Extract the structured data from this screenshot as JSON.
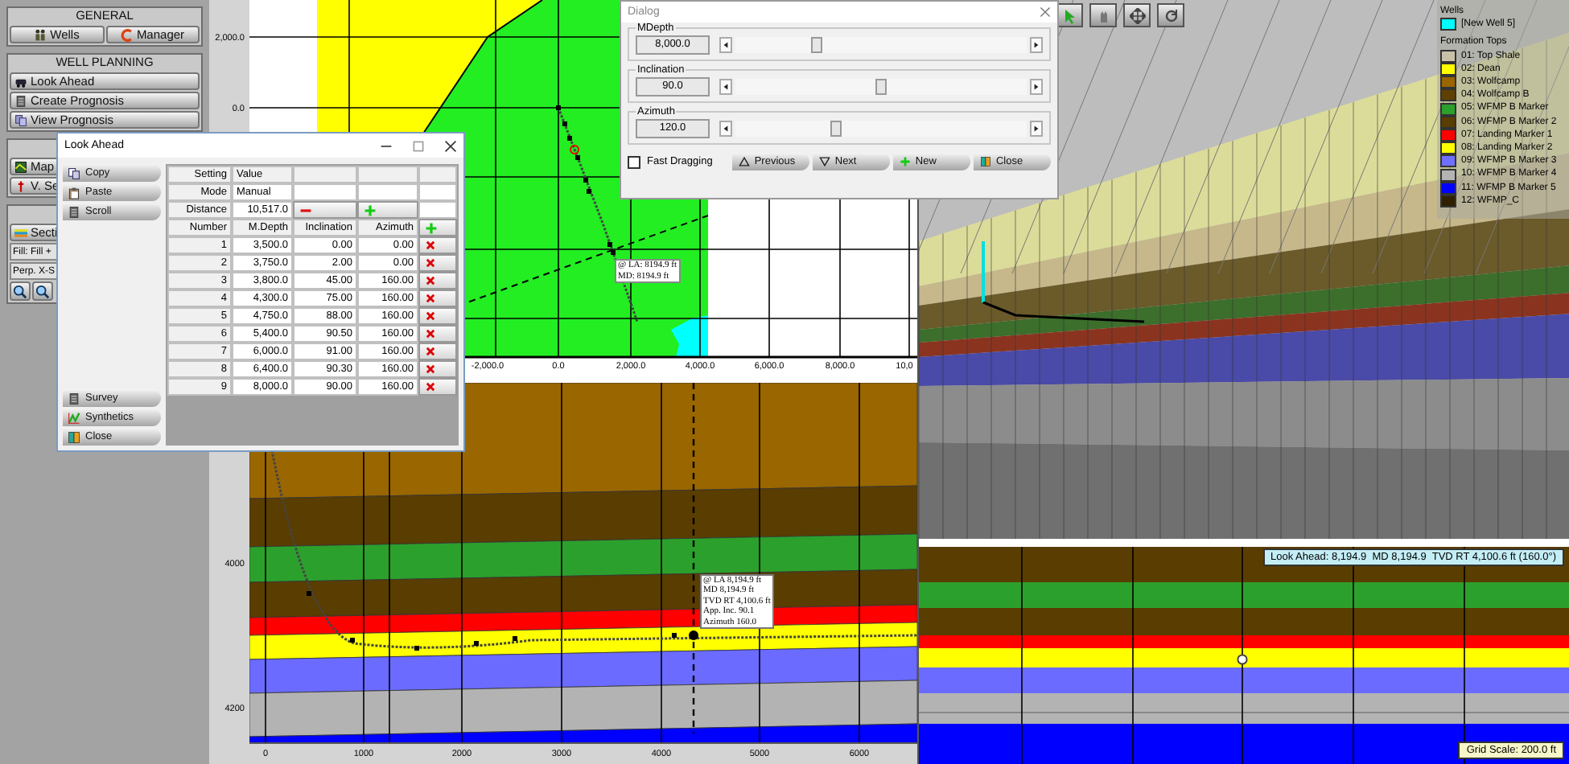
{
  "sidebar": {
    "sections": [
      {
        "title": "GENERAL",
        "buttons": [
          {
            "label": "Wells"
          },
          {
            "label": "Manager"
          }
        ]
      },
      {
        "title": "WELL PLANNING",
        "buttons": [
          {
            "label": "Look Ahead"
          },
          {
            "label": "Create Prognosis"
          },
          {
            "label": "View Prognosis"
          }
        ]
      },
      {
        "buttons": [
          {
            "label": "Map"
          },
          {
            "label": "V. Se"
          }
        ]
      },
      {
        "buttons": [
          {
            "label": "Secti"
          }
        ],
        "fields": [
          {
            "value": "Fill: Fill +"
          },
          {
            "value": "Perp. X-S"
          }
        ]
      }
    ]
  },
  "map_view": {
    "yticks": [
      "2,000.0",
      "0.0"
    ],
    "xticks": [
      "-2,000.0",
      "0.0",
      "2,000.0",
      "4,000.0",
      "6,000.0",
      "8,000.0",
      "10,0"
    ],
    "marker_label": [
      "@ LA: 8194.9 ft",
      "MD: 8194.9 ft"
    ]
  },
  "section_view": {
    "yticks": [
      "4000",
      "4200"
    ],
    "xticks": [
      "0",
      "1000",
      "2000",
      "3000",
      "4000",
      "5000",
      "6000"
    ],
    "tooltip": [
      "@ LA 8,194.9 ft",
      "MD 8,194.9 ft",
      "TVD RT 4,100.6 ft",
      "App. Inc. 90.1",
      "Azimuth 160.0"
    ]
  },
  "view_3d": {
    "legend": {
      "wells_title": "Wells",
      "wells": [
        {
          "name": "[New Well 5]",
          "color": "#00ffff"
        }
      ],
      "tops_title": "Formation Tops",
      "tops": [
        {
          "name": "01: Top Shale",
          "color": "#c8c0a8"
        },
        {
          "name": "02: Dean",
          "color": "#ffff00"
        },
        {
          "name": "03: Wolfcamp",
          "color": "#996600"
        },
        {
          "name": "04: Wolfcamp B",
          "color": "#604000"
        },
        {
          "name": "05: WFMP B Marker",
          "color": "#2ca02c"
        },
        {
          "name": "06: WFMP B Marker 2",
          "color": "#5a3d00"
        },
        {
          "name": "07: Landing Marker 1",
          "color": "#ff0000"
        },
        {
          "name": "08: Landing Marker 2",
          "color": "#ffff00"
        },
        {
          "name": "09: WFMP B Marker 3",
          "color": "#7070ff"
        },
        {
          "name": "10: WFMP B Marker 4",
          "color": "#b4b4b4"
        },
        {
          "name": "11: WFMP B Marker 5",
          "color": "#0000ff"
        },
        {
          "name": "12: WFMP_C",
          "color": "#302000"
        }
      ]
    }
  },
  "strip_view": {
    "status": "Look Ahead: 8,194.9  MD 8,194.9  TVD RT 4,100.6 ft (160.0°)",
    "grid_scale": "Grid Scale: 200.0 ft"
  },
  "look_ahead": {
    "title": "Look Ahead",
    "buttons": [
      "Copy",
      "Paste",
      "Scroll"
    ],
    "bottom_buttons": [
      "Survey",
      "Synthetics",
      "Close"
    ],
    "settings_header": [
      "Setting",
      "Value"
    ],
    "mode": {
      "label": "Mode",
      "value": "Manual"
    },
    "distance": {
      "label": "Distance",
      "value": "10,517.0"
    },
    "columns": [
      "Number",
      "M.Depth",
      "Inclination",
      "Azimuth"
    ],
    "rows": [
      [
        "1",
        "3,500.0",
        "0.00",
        "0.00"
      ],
      [
        "2",
        "3,750.0",
        "2.00",
        "0.00"
      ],
      [
        "3",
        "3,800.0",
        "45.00",
        "160.00"
      ],
      [
        "4",
        "4,300.0",
        "75.00",
        "160.00"
      ],
      [
        "5",
        "4,750.0",
        "88.00",
        "160.00"
      ],
      [
        "6",
        "5,400.0",
        "90.50",
        "160.00"
      ],
      [
        "7",
        "6,000.0",
        "91.00",
        "160.00"
      ],
      [
        "8",
        "6,400.0",
        "90.30",
        "160.00"
      ],
      [
        "9",
        "8,000.0",
        "90.00",
        "160.00"
      ]
    ]
  },
  "dialog": {
    "title": "Dialog",
    "sliders": [
      {
        "label": "MDepth",
        "value": "8,000.0",
        "level": 0.27
      },
      {
        "label": "Inclination",
        "value": "90.0",
        "level": 0.5
      },
      {
        "label": "Azimuth",
        "value": "120.0",
        "level": 0.34
      }
    ],
    "fast_dragging": {
      "label": "Fast Dragging",
      "checked": false
    },
    "buttons": [
      "Previous",
      "Next",
      "New",
      "Close"
    ]
  }
}
